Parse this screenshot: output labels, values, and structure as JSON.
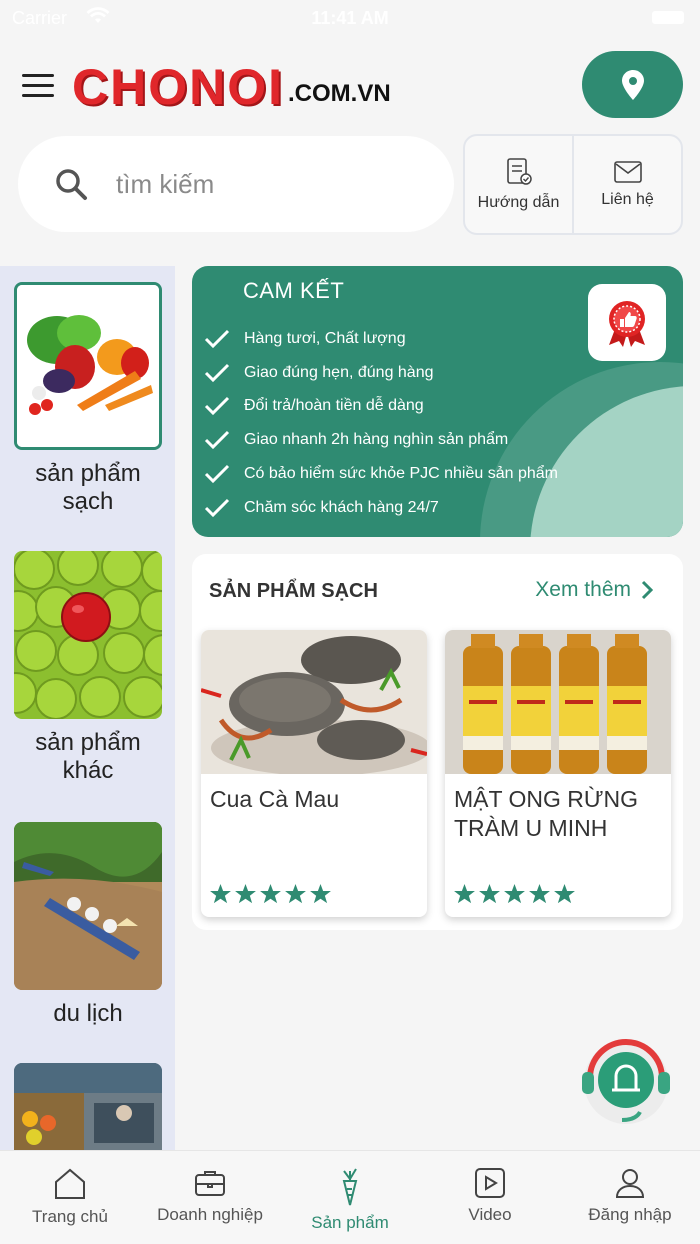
{
  "status_bar": {
    "carrier": "Carrier",
    "time": "11:41 AM"
  },
  "header": {
    "logo_main": "CHONOI",
    "logo_domain": ".COM.VN",
    "menu_icon": "hamburger-menu-icon",
    "location_icon": "map-pin-icon"
  },
  "search": {
    "placeholder": "tìm kiếm",
    "value": ""
  },
  "quick_links": [
    {
      "label": "Hướng dẫn",
      "icon": "guide-document-icon"
    },
    {
      "label": "Liên hệ",
      "icon": "mail-icon"
    }
  ],
  "categories": [
    {
      "label": "sản phẩm sạch",
      "active": true
    },
    {
      "label": "sản phẩm khác",
      "active": false
    },
    {
      "label": "du lịch",
      "active": false
    },
    {
      "label": "",
      "active": false
    }
  ],
  "promo": {
    "title": "CAM KẾT",
    "items": [
      "Hàng tươi, Chất lượng",
      "Giao đúng hẹn, đúng hàng",
      "Đổi trả/hoàn tiền dễ dàng",
      "Giao nhanh 2h hàng nghìn sản phẩm",
      "Có bảo hiểm sức khỏe PJC nhiều sản phẩm",
      "Chăm sóc khách hàng 24/7"
    ],
    "badge_icon": "thumbs-up-badge-icon"
  },
  "section": {
    "title": "SẢN PHẨM SẠCH",
    "more_label": "Xem thêm",
    "products": [
      {
        "name": "Cua Cà Mau",
        "rating": 5
      },
      {
        "name": "MẬT ONG RỪNG TRÀM U MINH",
        "rating": 5
      }
    ]
  },
  "tabs": [
    {
      "label": "Trang chủ",
      "icon": "home-icon",
      "active": false
    },
    {
      "label": "Doanh nghiệp",
      "icon": "briefcase-icon",
      "active": false
    },
    {
      "label": "Sản phẩm",
      "icon": "carrot-icon",
      "active": true
    },
    {
      "label": "Video",
      "icon": "video-play-icon",
      "active": false
    },
    {
      "label": "Đăng nhập",
      "icon": "user-icon",
      "active": false
    }
  ],
  "colors": {
    "primary": "#2f8b72",
    "logo_red": "#e0272b",
    "sidebar_bg": "#e4e7f4"
  }
}
